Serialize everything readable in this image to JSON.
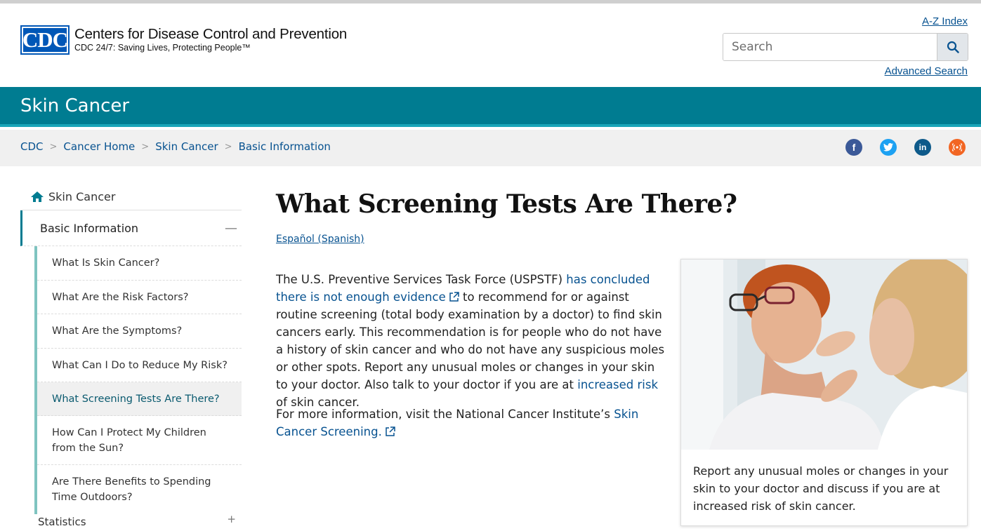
{
  "header": {
    "logo_mark": "CDC",
    "org_name": "Centers for Disease Control and Prevention",
    "tagline": "CDC 24/7: Saving Lives, Protecting People™",
    "az_index": "A-Z Index",
    "search_placeholder": "Search",
    "advanced_search": "Advanced Search"
  },
  "banner": {
    "title": "Skin Cancer"
  },
  "breadcrumb": [
    "CDC",
    "Cancer Home",
    "Skin Cancer",
    "Basic Information"
  ],
  "social": [
    "facebook-icon",
    "twitter-icon",
    "linkedin-icon",
    "syndicate-icon"
  ],
  "sidenav": {
    "home": "Skin Cancer",
    "section": "Basic Information",
    "items": [
      "What Is Skin Cancer?",
      "What Are the Risk Factors?",
      "What Are the Symptoms?",
      "What Can I Do to Reduce My Risk?",
      "What Screening Tests Are There?",
      "How Can I Protect My Children from the Sun?",
      "Are There Benefits to Spending Time Outdoors?"
    ],
    "next_section": "Statistics"
  },
  "main": {
    "title": "What Screening Tests Are There?",
    "language_link": "Español (Spanish)",
    "p1_a": "The U.S. Preventive Services Task Force (USPSTF) ",
    "p1_link": "has concluded there is not enough evidence",
    "p1_b": " to recommend for or against routine screening (total body examination by a doctor) to find skin cancers early. This recommendation is for people who do not have a history of skin cancer and who do not have any suspicious moles or other spots. Report any unusual moles or changes in your skin to your doctor. Also talk to your doctor if you are at ",
    "p1_link2": "increased risk",
    "p1_c": " of skin cancer.",
    "p2_a": "For more information, visit the National Cancer Institute’s ",
    "p2_link": "Skin Cancer Screening.",
    "caption": "Report any unusual moles or changes in your skin to your doctor and discuss if you are at increased risk of skin cancer."
  },
  "colors": {
    "brand_teal": "#007c91",
    "link": "#075290",
    "cdc_blue": "#0057b7"
  }
}
